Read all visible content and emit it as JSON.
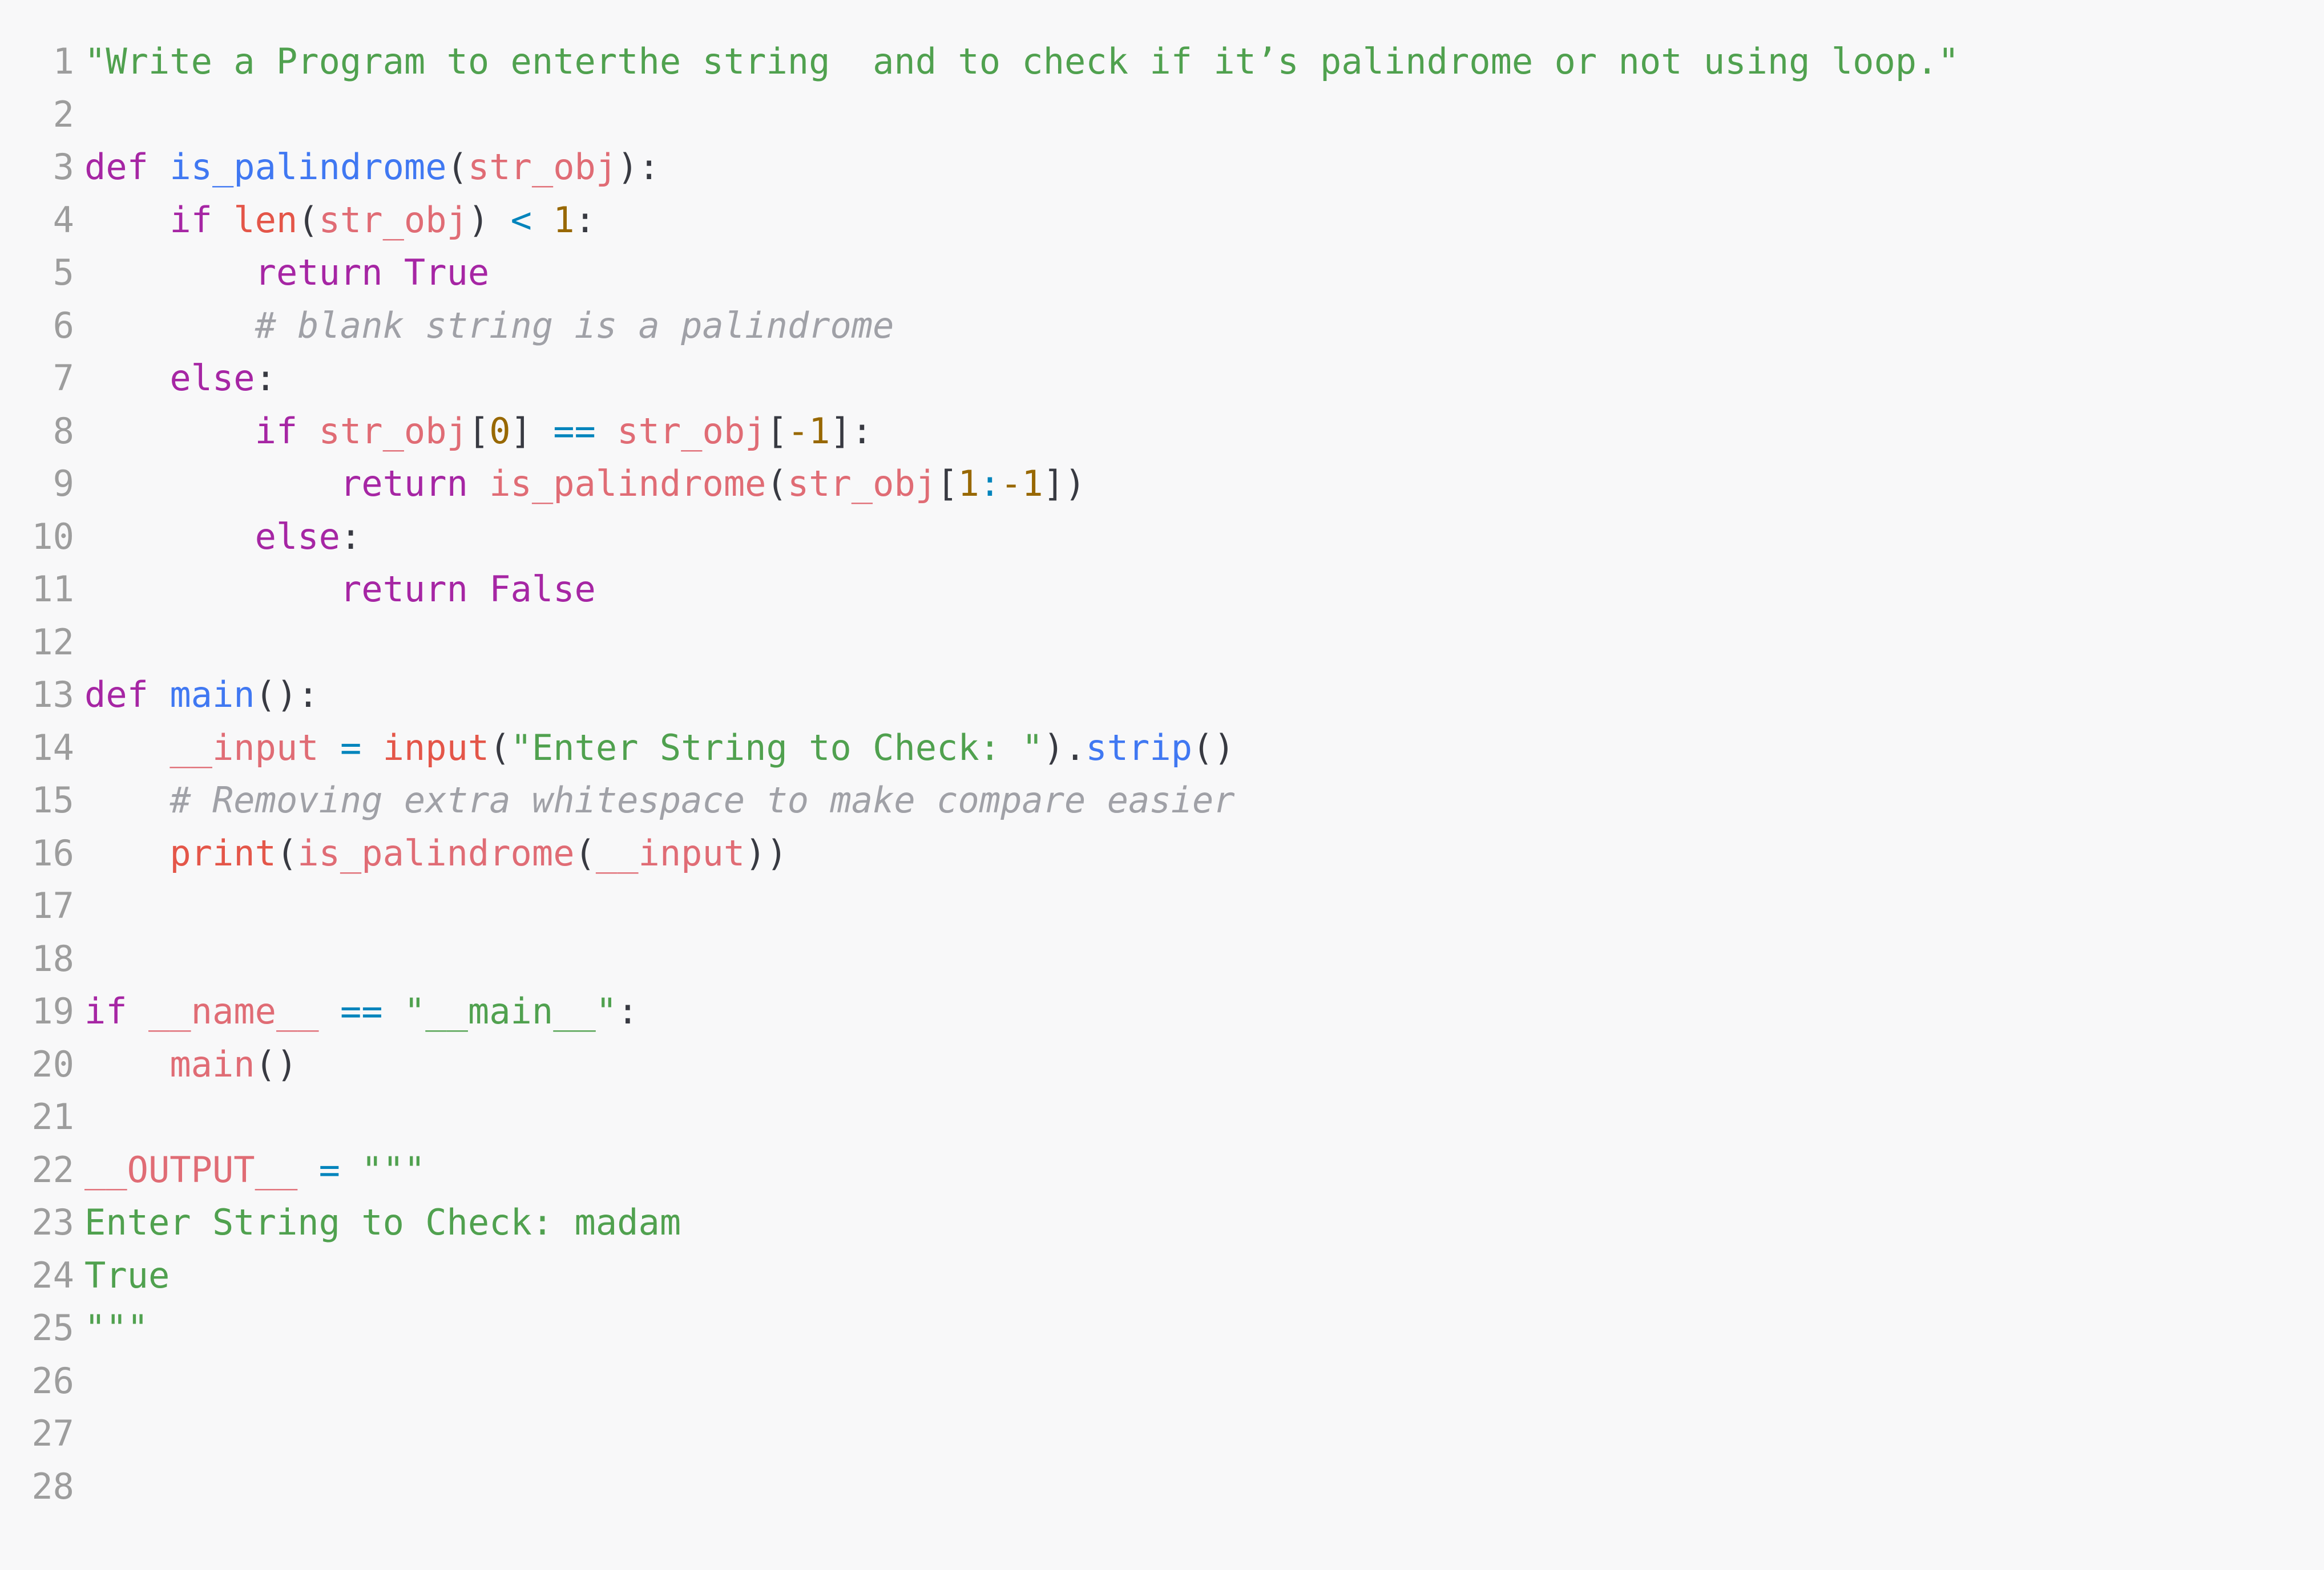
{
  "editor": {
    "language": "python",
    "theme_background": "#f8f8f9",
    "gutter_color": "#9d9d9d",
    "total_lines": 28
  },
  "colors": {
    "keyword": "#a626a4",
    "function": "#4078f2",
    "variable": "#e06c75",
    "builtin": "#e45649",
    "string": "#50a14f",
    "operator": "#0184bc",
    "number": "#986801",
    "comment": "#a0a1a7",
    "punctuation": "#383a42"
  },
  "lines": [
    {
      "number": "1",
      "tokens": [
        {
          "cls": "t-str",
          "text": "\"Write a Program to enterthe string  and to check if it’s palindrome or not using loop.\""
        }
      ]
    },
    {
      "number": "2",
      "tokens": []
    },
    {
      "number": "3",
      "tokens": [
        {
          "cls": "t-kw",
          "text": "def"
        },
        {
          "cls": "t-punc",
          "text": " "
        },
        {
          "cls": "t-fn",
          "text": "is_palindrome"
        },
        {
          "cls": "t-punc",
          "text": "("
        },
        {
          "cls": "t-var",
          "text": "str_obj"
        },
        {
          "cls": "t-punc",
          "text": "):"
        }
      ]
    },
    {
      "number": "4",
      "tokens": [
        {
          "cls": "t-punc",
          "text": "    "
        },
        {
          "cls": "t-kw",
          "text": "if"
        },
        {
          "cls": "t-punc",
          "text": " "
        },
        {
          "cls": "t-builtin",
          "text": "len"
        },
        {
          "cls": "t-punc",
          "text": "("
        },
        {
          "cls": "t-var",
          "text": "str_obj"
        },
        {
          "cls": "t-punc",
          "text": ") "
        },
        {
          "cls": "t-op",
          "text": "<"
        },
        {
          "cls": "t-punc",
          "text": " "
        },
        {
          "cls": "t-num",
          "text": "1"
        },
        {
          "cls": "t-punc",
          "text": ":"
        }
      ]
    },
    {
      "number": "5",
      "tokens": [
        {
          "cls": "t-punc",
          "text": "        "
        },
        {
          "cls": "t-kw",
          "text": "return True"
        }
      ]
    },
    {
      "number": "6",
      "tokens": [
        {
          "cls": "t-punc",
          "text": "        "
        },
        {
          "cls": "t-cmt",
          "text": "# blank string is a palindrome"
        }
      ]
    },
    {
      "number": "7",
      "tokens": [
        {
          "cls": "t-punc",
          "text": "    "
        },
        {
          "cls": "t-kw",
          "text": "else"
        },
        {
          "cls": "t-punc",
          "text": ":"
        }
      ]
    },
    {
      "number": "8",
      "tokens": [
        {
          "cls": "t-punc",
          "text": "        "
        },
        {
          "cls": "t-kw",
          "text": "if"
        },
        {
          "cls": "t-punc",
          "text": " "
        },
        {
          "cls": "t-var",
          "text": "str_obj"
        },
        {
          "cls": "t-punc",
          "text": "["
        },
        {
          "cls": "t-num",
          "text": "0"
        },
        {
          "cls": "t-punc",
          "text": "] "
        },
        {
          "cls": "t-op",
          "text": "=="
        },
        {
          "cls": "t-punc",
          "text": " "
        },
        {
          "cls": "t-var",
          "text": "str_obj"
        },
        {
          "cls": "t-punc",
          "text": "["
        },
        {
          "cls": "t-num",
          "text": "-1"
        },
        {
          "cls": "t-punc",
          "text": "]:"
        }
      ]
    },
    {
      "number": "9",
      "tokens": [
        {
          "cls": "t-punc",
          "text": "            "
        },
        {
          "cls": "t-kw",
          "text": "return"
        },
        {
          "cls": "t-punc",
          "text": " "
        },
        {
          "cls": "t-var",
          "text": "is_palindrome"
        },
        {
          "cls": "t-punc",
          "text": "("
        },
        {
          "cls": "t-var",
          "text": "str_obj"
        },
        {
          "cls": "t-punc",
          "text": "["
        },
        {
          "cls": "t-num",
          "text": "1"
        },
        {
          "cls": "t-op",
          "text": ":"
        },
        {
          "cls": "t-num",
          "text": "-1"
        },
        {
          "cls": "t-punc",
          "text": "])"
        }
      ]
    },
    {
      "number": "10",
      "tokens": [
        {
          "cls": "t-punc",
          "text": "        "
        },
        {
          "cls": "t-kw",
          "text": "else"
        },
        {
          "cls": "t-punc",
          "text": ":"
        }
      ]
    },
    {
      "number": "11",
      "tokens": [
        {
          "cls": "t-punc",
          "text": "            "
        },
        {
          "cls": "t-kw",
          "text": "return False"
        }
      ]
    },
    {
      "number": "12",
      "tokens": []
    },
    {
      "number": "13",
      "tokens": [
        {
          "cls": "t-kw",
          "text": "def"
        },
        {
          "cls": "t-punc",
          "text": " "
        },
        {
          "cls": "t-fn",
          "text": "main"
        },
        {
          "cls": "t-punc",
          "text": "():"
        }
      ]
    },
    {
      "number": "14",
      "tokens": [
        {
          "cls": "t-punc",
          "text": "    "
        },
        {
          "cls": "t-var",
          "text": "__input"
        },
        {
          "cls": "t-punc",
          "text": " "
        },
        {
          "cls": "t-op",
          "text": "="
        },
        {
          "cls": "t-punc",
          "text": " "
        },
        {
          "cls": "t-builtin",
          "text": "input"
        },
        {
          "cls": "t-punc",
          "text": "("
        },
        {
          "cls": "t-str",
          "text": "\"Enter String to Check: \""
        },
        {
          "cls": "t-punc",
          "text": ")."
        },
        {
          "cls": "t-fn",
          "text": "strip"
        },
        {
          "cls": "t-punc",
          "text": "()"
        }
      ]
    },
    {
      "number": "15",
      "tokens": [
        {
          "cls": "t-punc",
          "text": "    "
        },
        {
          "cls": "t-cmt",
          "text": "# Removing extra whitespace to make compare easier"
        }
      ]
    },
    {
      "number": "16",
      "tokens": [
        {
          "cls": "t-punc",
          "text": "    "
        },
        {
          "cls": "t-builtin",
          "text": "print"
        },
        {
          "cls": "t-punc",
          "text": "("
        },
        {
          "cls": "t-var",
          "text": "is_palindrome"
        },
        {
          "cls": "t-punc",
          "text": "("
        },
        {
          "cls": "t-var",
          "text": "__input"
        },
        {
          "cls": "t-punc",
          "text": "))"
        }
      ]
    },
    {
      "number": "17",
      "tokens": []
    },
    {
      "number": "18",
      "tokens": []
    },
    {
      "number": "19",
      "tokens": [
        {
          "cls": "t-kw",
          "text": "if"
        },
        {
          "cls": "t-punc",
          "text": " "
        },
        {
          "cls": "t-var",
          "text": "__name__"
        },
        {
          "cls": "t-punc",
          "text": " "
        },
        {
          "cls": "t-op",
          "text": "=="
        },
        {
          "cls": "t-punc",
          "text": " "
        },
        {
          "cls": "t-str",
          "text": "\"__main__\""
        },
        {
          "cls": "t-punc",
          "text": ":"
        }
      ]
    },
    {
      "number": "20",
      "tokens": [
        {
          "cls": "t-punc",
          "text": "    "
        },
        {
          "cls": "t-var",
          "text": "main"
        },
        {
          "cls": "t-punc",
          "text": "()"
        }
      ]
    },
    {
      "number": "21",
      "tokens": []
    },
    {
      "number": "22",
      "tokens": [
        {
          "cls": "t-var",
          "text": "__OUTPUT__"
        },
        {
          "cls": "t-punc",
          "text": " "
        },
        {
          "cls": "t-op",
          "text": "="
        },
        {
          "cls": "t-punc",
          "text": " "
        },
        {
          "cls": "t-str",
          "text": "\"\"\""
        }
      ]
    },
    {
      "number": "23",
      "tokens": [
        {
          "cls": "t-str",
          "text": "Enter String to Check: madam"
        }
      ]
    },
    {
      "number": "24",
      "tokens": [
        {
          "cls": "t-str",
          "text": "True"
        }
      ]
    },
    {
      "number": "25",
      "tokens": [
        {
          "cls": "t-str",
          "text": "\"\"\""
        }
      ]
    },
    {
      "number": "26",
      "tokens": []
    },
    {
      "number": "27",
      "tokens": []
    },
    {
      "number": "28",
      "tokens": []
    }
  ]
}
